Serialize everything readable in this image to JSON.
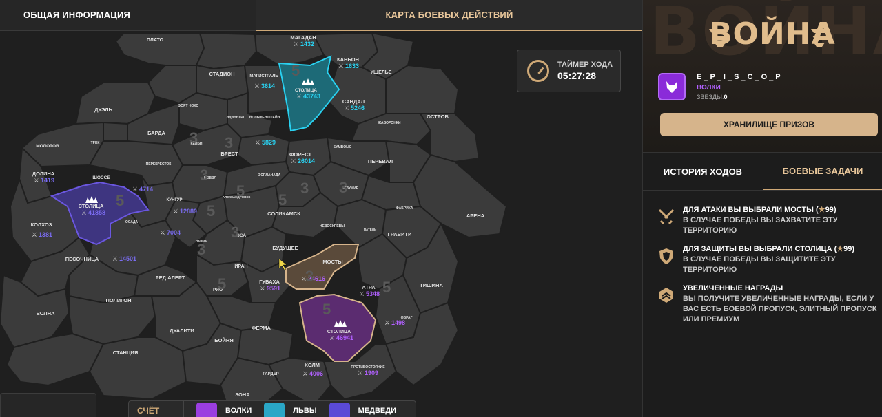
{
  "tabs": {
    "info": "ОБЩАЯ ИНФОРМАЦИЯ",
    "map": "КАРТА БОЕВЫХ ДЕЙСТВИЙ"
  },
  "timer": {
    "label": "ТАЙМЕР ХОДА",
    "value": "05:27:28"
  },
  "score": {
    "label": "СЧЁТ",
    "factions": [
      {
        "name": "ВОЛКИ",
        "color": "#9b3ee0"
      },
      {
        "name": "ЛЬВЫ",
        "color": "#2aa7c7"
      },
      {
        "name": "МЕДВЕДИ",
        "color": "#5a4ad6"
      }
    ]
  },
  "right": {
    "logo": "ВОЙНА",
    "user": {
      "name": "E_P_I_S_C_O_P",
      "faction": "ВОЛКИ",
      "stars_label": "ЗВЁЗДЫ:",
      "stars": "0"
    },
    "prize_button": "ХРАНИЛИЩЕ ПРИЗОВ",
    "tab_history": "ИСТОРИЯ ХОДОВ",
    "tab_tasks": "БОЕВЫЕ ЗАДАЧИ",
    "tasks": [
      {
        "icon": "crossed-swords-icon",
        "title_pre": "ДЛЯ АТАКИ ВЫ ВЫБРАЛИ МОСТЫ (",
        "title_val": "99",
        "title_post": ")",
        "desc": "В СЛУЧАЕ ПОБЕДЫ ВЫ ЗАХВАТИТЕ ЭТУ ТЕРРИТОРИЮ"
      },
      {
        "icon": "shield-icon",
        "title_pre": "ДЛЯ ЗАЩИТЫ ВЫ ВЫБРАЛИ СТОЛИЦА (",
        "title_val": "99",
        "title_post": ")",
        "desc": "В СЛУЧАЕ ПОБЕДЫ ВЫ ЗАЩИТИТЕ ЭТУ ТЕРРИТОРИЮ"
      },
      {
        "icon": "rank-badge-icon",
        "title_pre": "УВЕЛИЧЕННЫЕ НАГРАДЫ",
        "title_val": "",
        "title_post": "",
        "desc": "ВЫ ПОЛУЧИТЕ УВЕЛИЧЕННЫЕ НАГРАДЫ, ЕСЛИ У ВАС ЕСТЬ БОЕВОЙ ПРОПУСК, ЭЛИТНЫЙ ПРОПУСК ИЛИ ПРЕМИУМ"
      }
    ]
  },
  "colors": {
    "accent": "#cfa977",
    "lions": "#2aa7c7",
    "bears": "#6b57e0",
    "wolves": "#b160ff"
  },
  "map": {
    "labels": [
      "ПЛАТО",
      "МАГАДАН",
      "КАНЬОН",
      "УЩЕЛЬЕ",
      "СТАДИОН",
      "МАГИСТРАЛЬ",
      "СТОЛИЦА",
      "САНДАЛ",
      "ДУЭЛЬ",
      "ФОРТ НОКС",
      "ЭДИНБУРГ",
      "ЖАВОРОНКИ",
      "ОСТРОВ",
      "БАРДА",
      "ВОЛЬФЕНШТЕЙН",
      "ТРЕК",
      "КЁЛЬН",
      "БРЕСТ",
      "ФОРЕСТ",
      "SYMBOLIC",
      "МОЛОТОВ",
      "ПЕРЕКРЁСТОК",
      "ЭСПЛАНАДА",
      "ПЕРЕВАЛ",
      "ДОЛИНА",
      "ШОССЕ",
      "НОВЭЛ",
      "БЕЗУМИЕ",
      "СТОЛИЦА",
      "КУНГУР",
      "АЛЕКСАНДРОВСК",
      "ФАБРИКА",
      "СОЛИКАМСК",
      "ОСАДА",
      "АРЕНА",
      "КОЛХОЗ",
      "ПАРМА",
      "ОСА",
      "НЕВОСКРЁВЫ",
      "ПАТЕЛЬ",
      "ГРАВИТИ",
      "БУДУЩЕЕ",
      "ПЕСОЧНИЦА",
      "ИРАН",
      "МОСТЫ",
      "РЕД АЛЕРТ",
      "ГУБАХА",
      "АТРА",
      "ТИШИНА",
      "РИО",
      "ПОЛИГОН",
      "ВОЛНА",
      "ОВРАГ",
      "СТОЛИЦА",
      "ДУАЛИТИ",
      "ФЕРМА",
      "БОЙНЯ",
      "СТАНЦИЯ",
      "ХОЛМ",
      "ПРОТИВОСТОЯНИЕ",
      "ГАРДЕР",
      "ЗОНА"
    ],
    "scores": [
      "1432",
      "1633",
      "3614",
      "43743",
      "5246",
      "5829",
      "26014",
      "1419",
      "4714",
      "41858",
      "12889",
      "7004",
      "1381",
      "14501",
      "24616",
      "5348",
      "9591",
      "1498",
      "46941",
      "4006",
      "1909"
    ],
    "region_levels": [
      "5",
      "3",
      "3",
      "3",
      "5",
      "5",
      "3",
      "3",
      "5",
      "5",
      "3",
      "5",
      "3",
      "3",
      "5",
      "5"
    ]
  }
}
